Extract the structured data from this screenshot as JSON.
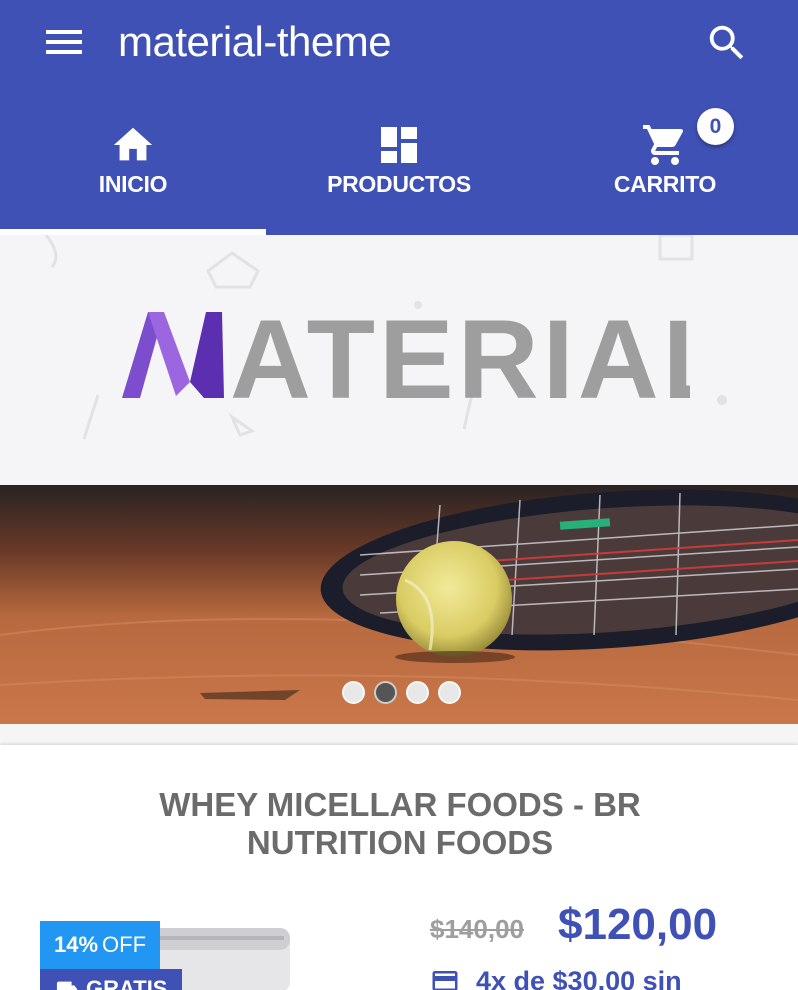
{
  "app": {
    "title": "material-theme"
  },
  "tabs": [
    {
      "label": "INICIO",
      "icon": "home-icon"
    },
    {
      "label": "PRODUCTOS",
      "icon": "dashboard-icon"
    },
    {
      "label": "CARRITO",
      "icon": "cart-icon"
    }
  ],
  "cart": {
    "count": "0"
  },
  "hero": {
    "logo_text": "MATERIAL"
  },
  "slider": {
    "total_slides": 4,
    "active_index": 1
  },
  "product": {
    "title": "WHEY MICELLAR FOODS - BR NUTRITION FOODS",
    "old_price": "$140,00",
    "price": "$120,00",
    "installments": "4x de $30,00 sin",
    "discount_percent": "14%",
    "discount_label": "OFF",
    "shipping_label": "GRATIS"
  },
  "colors": {
    "primary": "#3f51b5",
    "accent_blue": "#2196f3",
    "logo_purple": "#6a3fc0",
    "logo_gray": "#9e9e9e"
  }
}
